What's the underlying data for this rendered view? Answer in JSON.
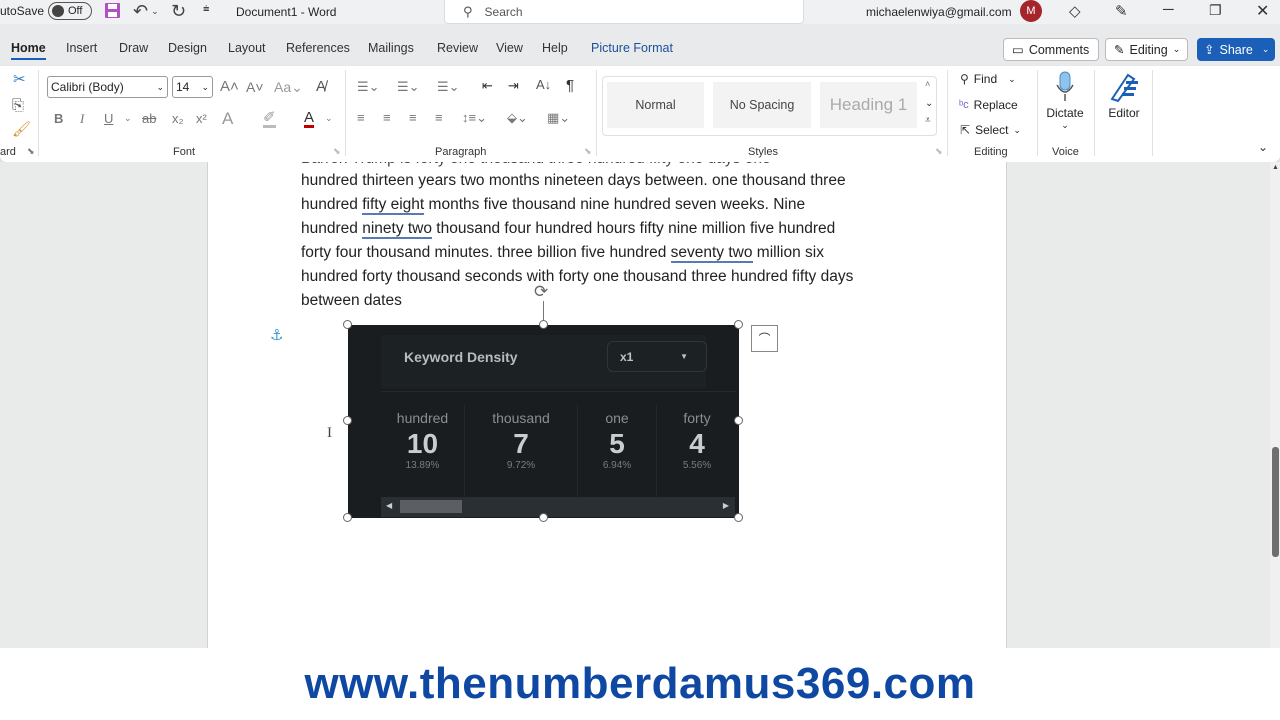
{
  "titlebar": {
    "autosave_label": "utoSave",
    "autosave_state": "Off",
    "doc_title": "Document1 - Word",
    "search_placeholder": "Search",
    "account_email": "michaelenwiya@gmail.com",
    "avatar_initial": "M"
  },
  "menu": {
    "tabs": [
      "Home",
      "Insert",
      "Draw",
      "Design",
      "Layout",
      "References",
      "Mailings",
      "Review",
      "View",
      "Help",
      "Picture Format"
    ],
    "comments_label": "Comments",
    "editing_label": "Editing",
    "share_label": "Share"
  },
  "ribbon": {
    "clipboard_label": "ard",
    "font_name": "Calibri (Body)",
    "font_size": "14",
    "font_group_label": "Font",
    "paragraph_group_label": "Paragraph",
    "styles": [
      "Normal",
      "No Spacing",
      "Heading 1"
    ],
    "styles_group_label": "Styles",
    "find_label": "Find",
    "replace_label": "Replace",
    "select_label": "Select",
    "editing_group_label": "Editing",
    "dictate_label": "Dictate",
    "voice_group_label": "Voice",
    "editor_label": "Editor"
  },
  "document": {
    "line0": "Barron Trump is forty one thousand three hundred fifty one days one",
    "lines": [
      [
        {
          "t": "hundred thirteen years two months nineteen days between. one thousand three",
          "u": false
        }
      ],
      [
        {
          "t": "hundred ",
          "u": false
        },
        {
          "t": "fifty eight",
          "u": true
        },
        {
          "t": " months five thousand nine hundred seven weeks. Nine",
          "u": false
        }
      ],
      [
        {
          "t": "hundred ",
          "u": false
        },
        {
          "t": "ninety two",
          "u": true
        },
        {
          "t": " thousand four hundred hours fifty nine million five hundred",
          "u": false
        }
      ],
      [
        {
          "t": "forty four thousand minutes. three billion five hundred ",
          "u": false
        },
        {
          "t": "seventy two",
          "u": true
        },
        {
          "t": " million six",
          "u": false
        }
      ],
      [
        {
          "t": "hundred forty thousand seconds with forty one thousand three hundred fifty days",
          "u": false
        }
      ],
      [
        {
          "t": "between dates",
          "u": false
        }
      ]
    ]
  },
  "widget": {
    "title": "Keyword Density",
    "dropdown_value": "x1",
    "keywords": [
      {
        "word": "hundred",
        "count": "10",
        "percent": "13.89%"
      },
      {
        "word": "thousand",
        "count": "7",
        "percent": "9.72%"
      },
      {
        "word": "one",
        "count": "5",
        "percent": "6.94%"
      },
      {
        "word": "forty",
        "count": "4",
        "percent": "5.56%"
      }
    ],
    "scroll_position": 0.1
  },
  "footer": {
    "url": "www.thenumberdamus369.com"
  },
  "colors": {
    "accent": "#185abd",
    "share": "#1c5fb8",
    "footer_text": "#0f48a3",
    "widget_bg": "#191d20"
  }
}
